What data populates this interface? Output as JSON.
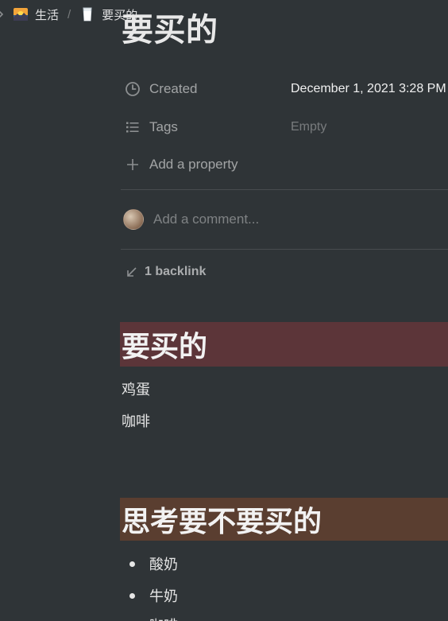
{
  "breadcrumb": {
    "items": [
      {
        "label": "生活",
        "icon": "sunset-emoji-icon"
      },
      {
        "label": "要买的",
        "icon": "milk-glass-emoji-icon"
      }
    ],
    "separator": "/"
  },
  "page": {
    "title": "要买的"
  },
  "properties": [
    {
      "name": "Created",
      "icon": "clock-icon",
      "value": "December 1, 2021 3:28 PM"
    },
    {
      "name": "Tags",
      "icon": "list-icon",
      "value": "Empty"
    }
  ],
  "add_property": {
    "label": "Add a property",
    "icon": "plus-icon"
  },
  "comment": {
    "placeholder": "Add a comment..."
  },
  "backlinks": {
    "label": "1 backlink",
    "icon": "arrow-down-left-icon"
  },
  "sections": [
    {
      "heading": "要买的",
      "heading_color": "#5c3539",
      "lines": [
        "鸡蛋",
        "咖啡"
      ]
    },
    {
      "heading": "思考要不要买的",
      "heading_color": "#5a3e30",
      "bullets": [
        "酸奶",
        "牛奶",
        "咖啡"
      ]
    }
  ],
  "colors": {
    "background": "#2f3437",
    "text": "#e6e6e6",
    "muted": "#8d8f91"
  }
}
